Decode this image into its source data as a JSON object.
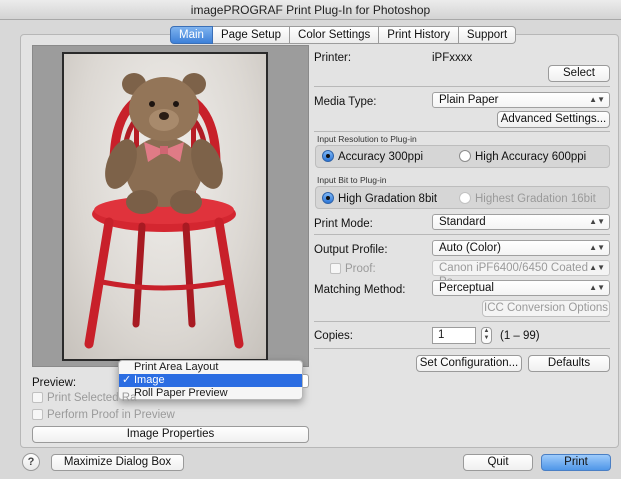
{
  "window": {
    "title": "imagePROGRAF Print Plug-In for Photoshop"
  },
  "tabs": [
    {
      "label": "Main",
      "active": true
    },
    {
      "label": "Page Setup",
      "active": false
    },
    {
      "label": "Color Settings",
      "active": false
    },
    {
      "label": "Print History",
      "active": false
    },
    {
      "label": "Support",
      "active": false
    }
  ],
  "printer": {
    "label": "Printer:",
    "value": "iPFxxxx",
    "select_button": "Select"
  },
  "media": {
    "label": "Media Type:",
    "value": "Plain Paper",
    "advanced_button": "Advanced Settings..."
  },
  "resolution": {
    "title": "Input Resolution to Plug-in",
    "options": [
      {
        "label": "Accuracy 300ppi",
        "selected": true,
        "enabled": true
      },
      {
        "label": "High Accuracy 600ppi",
        "selected": false,
        "enabled": true
      }
    ]
  },
  "bit": {
    "title": "Input Bit to Plug-in",
    "options": [
      {
        "label": "High Gradation 8bit",
        "selected": true,
        "enabled": true
      },
      {
        "label": "Highest Gradation 16bit",
        "selected": false,
        "enabled": false
      }
    ]
  },
  "print_mode": {
    "label": "Print Mode:",
    "value": "Standard"
  },
  "output_profile": {
    "label": "Output Profile:",
    "value": "Auto (Color)"
  },
  "proof": {
    "label": "Proof:",
    "value": "Canon iPF6400/6450 Coated Pa..."
  },
  "matching": {
    "label": "Matching Method:",
    "value": "Perceptual",
    "icc_button": "ICC Conversion Options"
  },
  "copies": {
    "label": "Copies:",
    "value": "1",
    "range": "(1 – 99)"
  },
  "config_buttons": {
    "set_configuration": "Set Configuration...",
    "defaults": "Defaults"
  },
  "preview_section": {
    "label": "Preview:",
    "print_selected": "Print Selected Ra",
    "perform_proof": "Perform Proof in Preview",
    "image_properties": "Image Properties"
  },
  "preview_menu": {
    "items": [
      {
        "label": "Print Area Layout",
        "checked": false,
        "highlighted": false
      },
      {
        "label": "Image",
        "checked": true,
        "highlighted": true
      },
      {
        "label": "Roll Paper Preview",
        "checked": false,
        "highlighted": false
      }
    ],
    "check_glyph": "✓"
  },
  "footer": {
    "help": "?",
    "maximize": "Maximize Dialog Box",
    "quit": "Quit",
    "print": "Print"
  },
  "colors": {
    "accent": "#2b6de2",
    "chair": "#c8202a",
    "bear": "#8a6d52",
    "ribbon": "#e07b86"
  }
}
